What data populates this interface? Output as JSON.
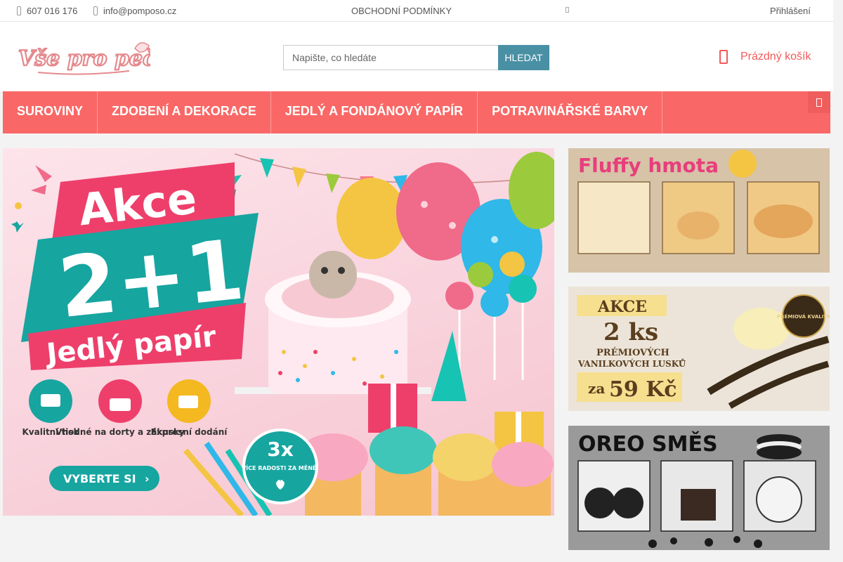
{
  "topbar": {
    "phone": "607 016 176",
    "email": "info@pomposo.cz",
    "terms": "OBCHODNÍ PODMÍNKY",
    "login": "Přihlášení"
  },
  "header": {
    "logo_text": "Vše pro pečení",
    "search_placeholder": "Napište, co hledáte",
    "search_button": "HLEDAT",
    "cart_label": "Prázdný košík"
  },
  "nav": {
    "items": [
      "SUROVINY",
      "ZDOBENÍ A DEKORACE",
      "JEDLÝ A FONDÁNOVÝ PAPÍR",
      "POTRAVINÁŘSKÉ BARVY"
    ]
  },
  "hero": {
    "akce": "Akce",
    "offer": "2+1",
    "product": "Jedlý papír",
    "features": [
      "Kvalitní tisk",
      "Vhodné na dorty a zákusky",
      "Expresní dodání"
    ],
    "cta": "VYBERTE SI",
    "badge_big": "3x",
    "badge_small": "VÍCE RADOSTI ZA MĚNĚ!"
  },
  "side_banners": {
    "fluffy_title": "Fluffy hmota",
    "vanilla_akce": "AKCE",
    "vanilla_qty": "2 ks",
    "vanilla_line1": "PRÉMIOVÝCH",
    "vanilla_line2": "VANILKOVÝCH LUSKŮ",
    "vanilla_price_prefix": "za",
    "vanilla_price": "59 Kč",
    "vanilla_badge": "PRÉMIOVÁ KVALITA",
    "oreo_title": "OREO SMĚS"
  },
  "colors": {
    "accent": "#f96866",
    "search_button": "#4a90a4",
    "teal": "#17a5a0",
    "cart": "#f4595b"
  }
}
